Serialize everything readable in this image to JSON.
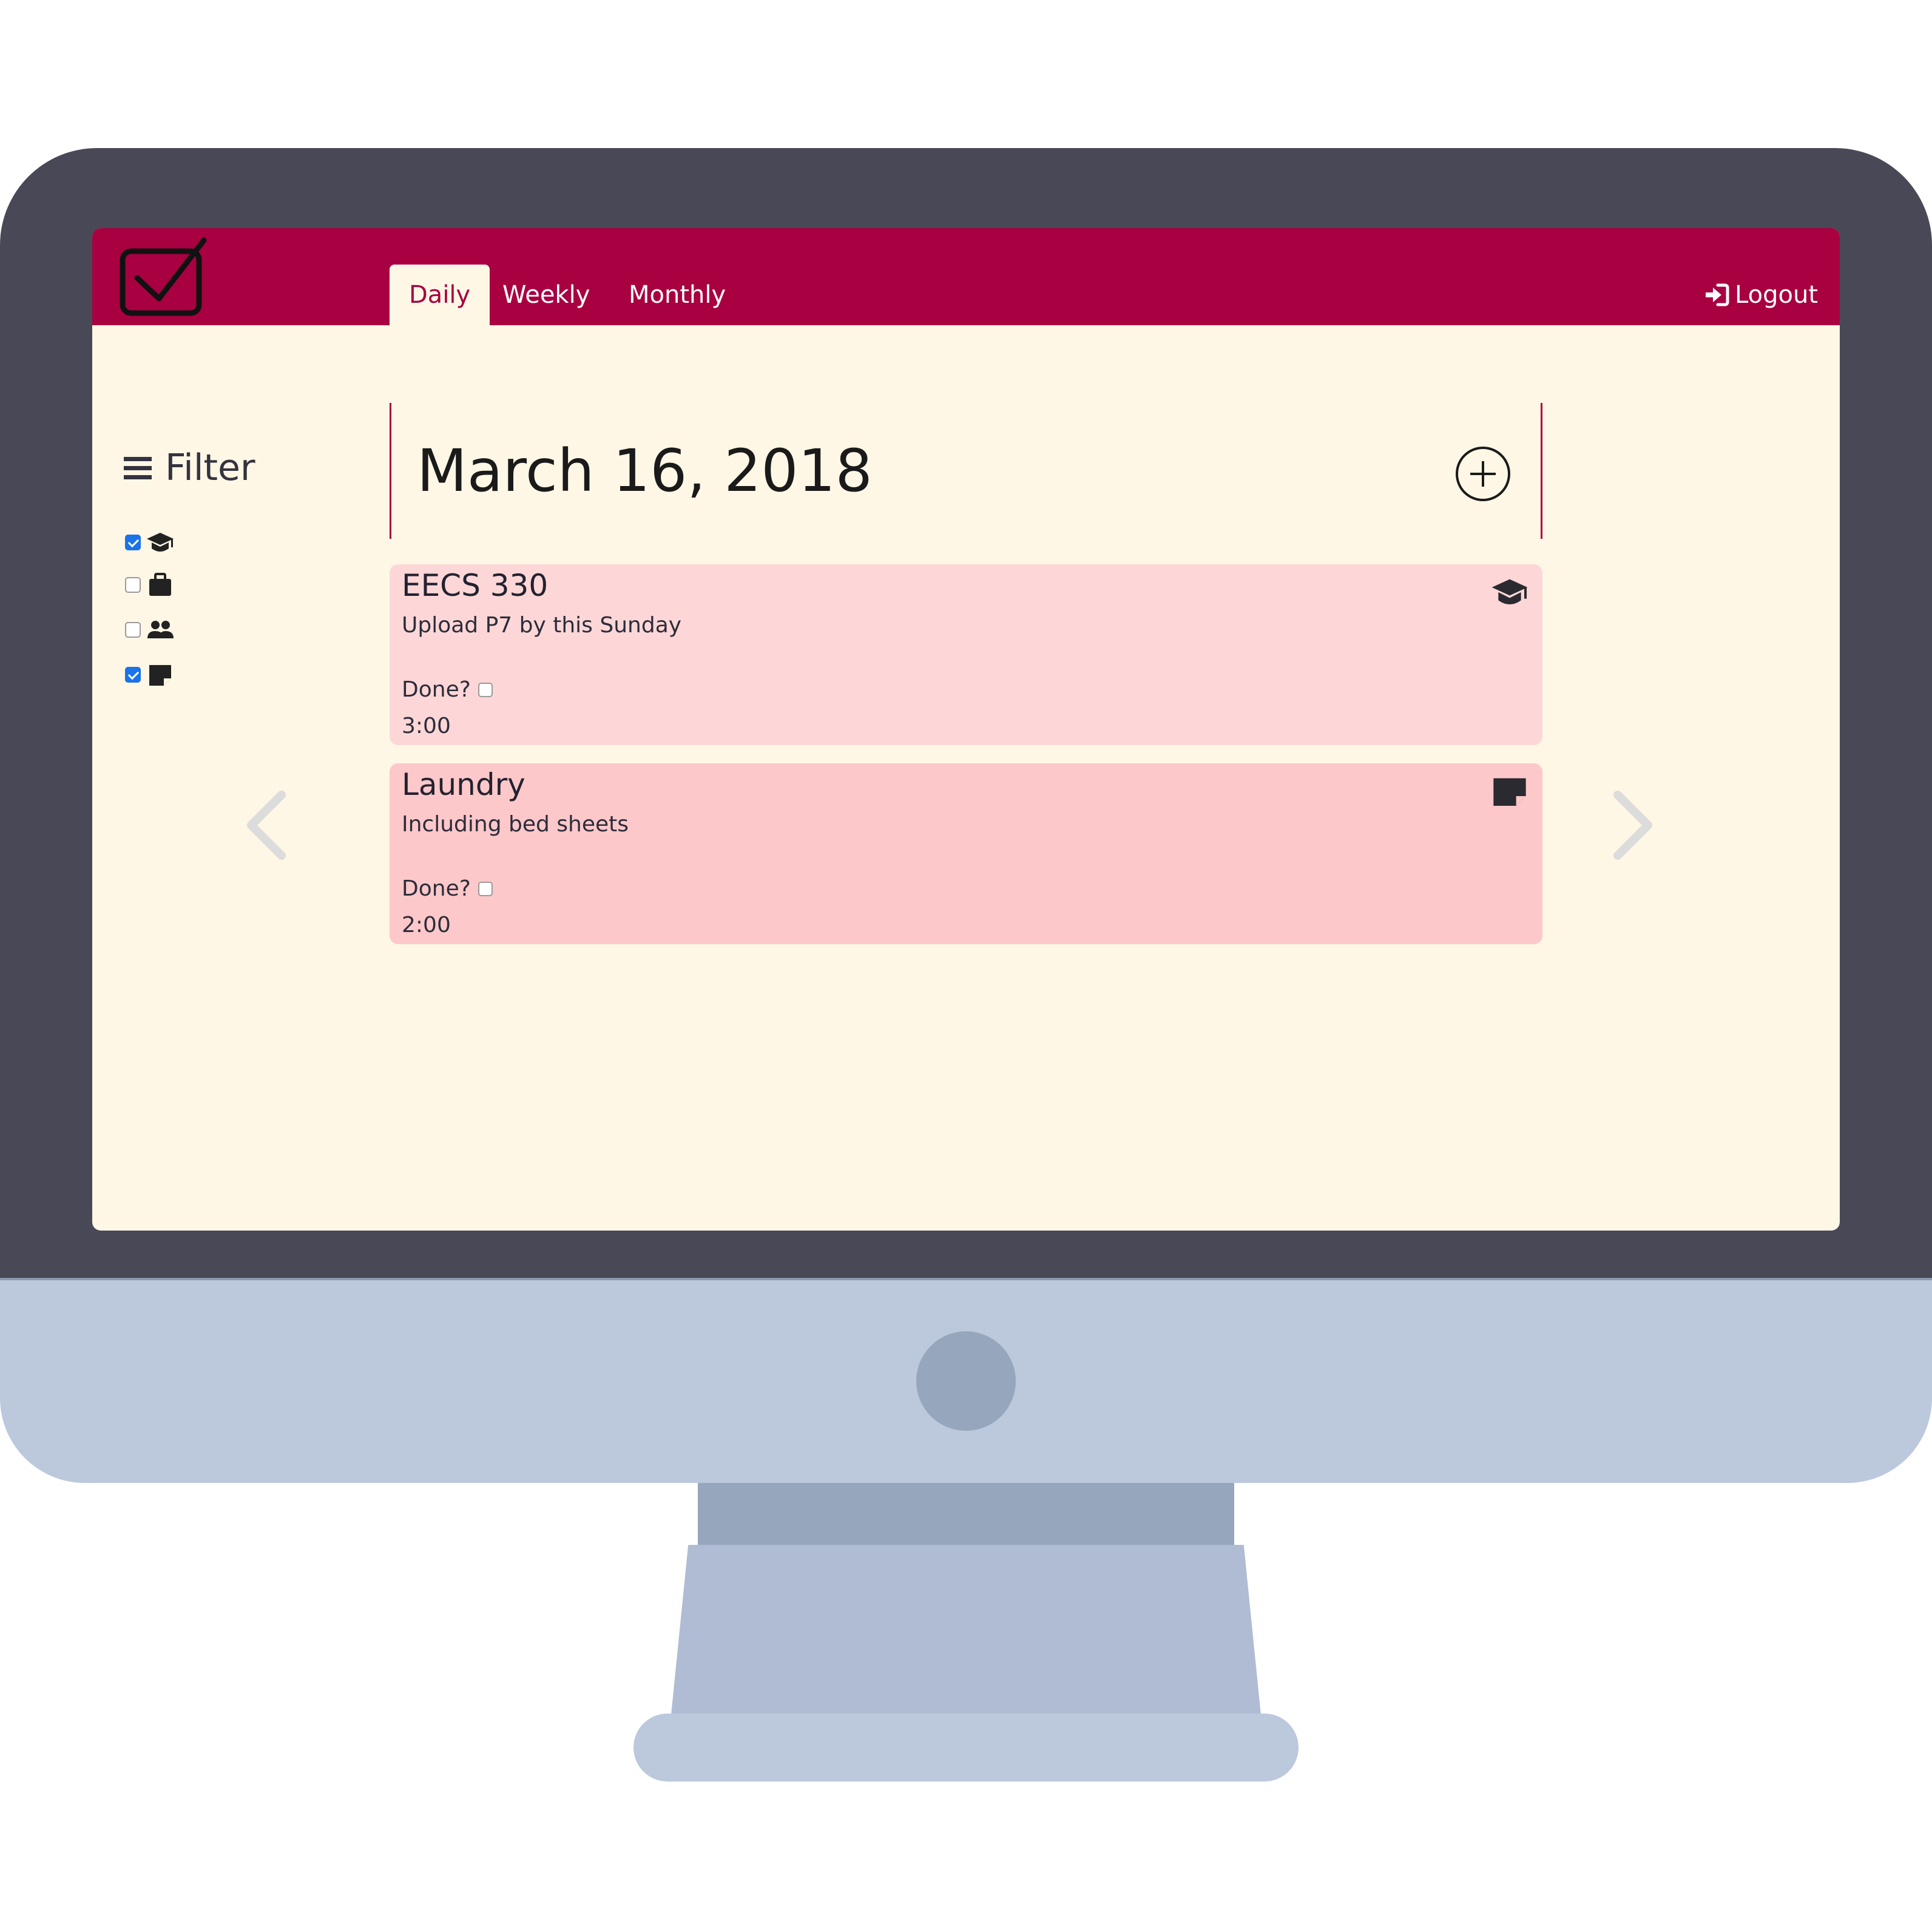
{
  "nav": {
    "tabs": [
      {
        "label": "Daily",
        "active": true
      },
      {
        "label": "Weekly",
        "active": false
      },
      {
        "label": "Monthly",
        "active": false
      }
    ],
    "logout_label": "Logout",
    "logout_icon": "sign-in-icon"
  },
  "filter": {
    "title": "Filter",
    "icon": "bars-icon",
    "items": [
      {
        "icon": "graduation-cap-icon",
        "checked": true
      },
      {
        "icon": "briefcase-icon",
        "checked": false
      },
      {
        "icon": "users-icon",
        "checked": false
      },
      {
        "icon": "sticky-note-icon",
        "checked": true
      }
    ]
  },
  "date_header": {
    "date": "March 16, 2018"
  },
  "tasks": [
    {
      "title": "EECS 330",
      "description": "Upload P7 by this Sunday",
      "done_label": "Done?",
      "done": false,
      "time": "3:00",
      "icon": "graduation-cap-icon"
    },
    {
      "title": "Laundry",
      "description": "Including bed sheets",
      "done_label": "Done?",
      "done": false,
      "time": "2:00",
      "icon": "sticky-note-icon"
    }
  ],
  "colors": {
    "brand": "#a80041",
    "background": "#fef7e5",
    "card_school": "#fdd7d7",
    "card_note": "#fdc8ca",
    "bezel": "#484856",
    "stand": "#bcc8dc"
  }
}
